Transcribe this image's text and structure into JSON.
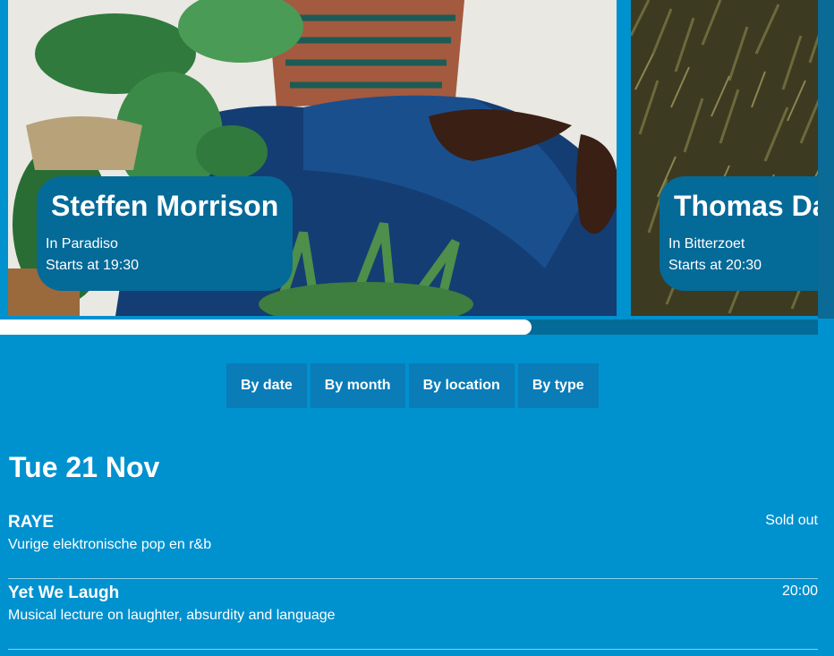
{
  "featured": [
    {
      "name": "Steffen Morrison",
      "venue": "In Paradiso",
      "start": "Starts at 19:30"
    },
    {
      "name": "Thomas Da",
      "venue": "In Bitterzoet",
      "start": "Starts at 20:30"
    }
  ],
  "carousel_progress": 0.65,
  "filters": [
    "By date",
    "By month",
    "By location",
    "By type"
  ],
  "date_heading": "Tue 21 Nov",
  "events": [
    {
      "title": "RAYE",
      "description": "Vurige elektronische pop en r&b",
      "status": "Sold out"
    },
    {
      "title": "Yet We Laugh",
      "description": "Musical lecture on laughter, absurdity and language",
      "status": "20:00"
    }
  ],
  "colors": {
    "background": "#0091cf",
    "overlay": "#046a98",
    "tab": "#0a7cb8",
    "text": "#ffffff"
  }
}
